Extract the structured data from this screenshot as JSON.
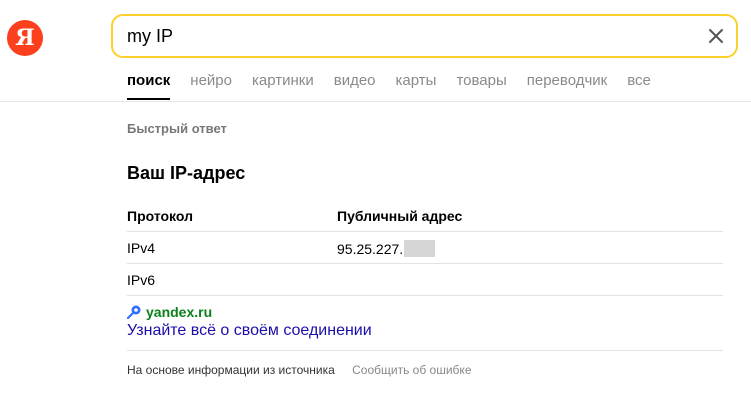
{
  "logo": {
    "letter": "Я"
  },
  "search": {
    "query": "my IP"
  },
  "tabs": [
    {
      "label": "поиск",
      "active": true
    },
    {
      "label": "нейро"
    },
    {
      "label": "картинки"
    },
    {
      "label": "видео"
    },
    {
      "label": "карты"
    },
    {
      "label": "товары"
    },
    {
      "label": "переводчик"
    },
    {
      "label": "все"
    }
  ],
  "answer": {
    "section_label": "Быстрый ответ",
    "title": "Ваш IP-адрес",
    "headers": {
      "protocol": "Протокол",
      "address": "Публичный адрес"
    },
    "rows": [
      {
        "protocol": "IPv4",
        "address": "95.25.227."
      },
      {
        "protocol": "IPv6",
        "address": ""
      }
    ],
    "source_name": "yandex.ru",
    "link_text": "Узнайте всё о своём соединении",
    "footer_text": "На основе информации из источника",
    "report_text": "Сообщить об ошибке"
  },
  "colors": {
    "logo": "#fc3f1d",
    "search_border": "#fdd02b",
    "link": "#1a0dab",
    "source": "#0a7f1a"
  }
}
